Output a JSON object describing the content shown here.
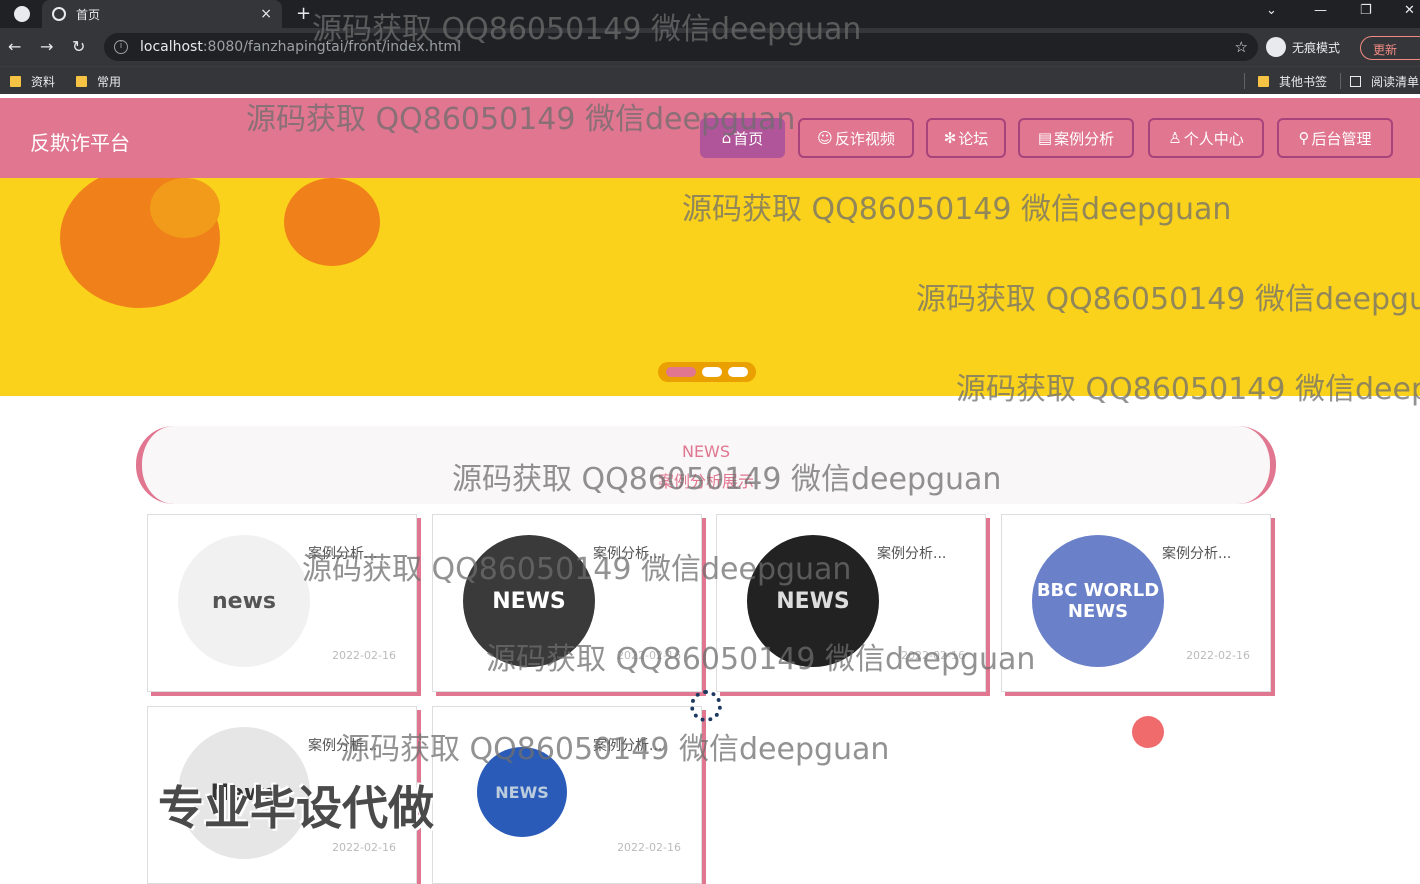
{
  "browser": {
    "tab_title": "首页",
    "tab_close": "×",
    "new_tab": "+",
    "url_host": "localhost",
    "url_rest": ":8080/fanzhapingtai/front/index.html",
    "incognito_label": "无痕模式",
    "update_label": "更新",
    "bookmarks": [
      "资料",
      "常用",
      "其他书签",
      "阅读清单"
    ]
  },
  "site": {
    "logo": "反欺诈平台",
    "nav": [
      {
        "icon": "⌂",
        "label": "首页"
      },
      {
        "icon": "☺",
        "label": "反诈视频"
      },
      {
        "icon": "✻",
        "label": "论坛"
      },
      {
        "icon": "▤",
        "label": "案例分析"
      },
      {
        "icon": "♙",
        "label": "个人中心"
      },
      {
        "icon": "⚲",
        "label": "后台管理"
      }
    ],
    "section_en": "NEWS",
    "section_cn": "案例分析展示",
    "cards": [
      {
        "title": "案例分析...",
        "date": "2022-02-16",
        "img_text": "news"
      },
      {
        "title": "案例分析...",
        "date": "2022-02-16",
        "img_text": "NEWS"
      },
      {
        "title": "案例分析...",
        "date": "2022-02-16",
        "img_text": "NEWS"
      },
      {
        "title": "案例分析...",
        "date": "2022-02-16",
        "img_text": "BBC WORLD NEWS"
      },
      {
        "title": "案例分析...",
        "date": "2022-02-16",
        "img_text": "News"
      },
      {
        "title": "案例分析...",
        "date": "2022-02-16",
        "img_text": "NEWS"
      }
    ]
  },
  "watermark": "源码获取 QQ86050149 微信deepguan",
  "big_watermark": "专业毕设代做",
  "colors": {
    "header": "#e0768f",
    "banner": "#fbd21b",
    "accent": "#b05599"
  }
}
